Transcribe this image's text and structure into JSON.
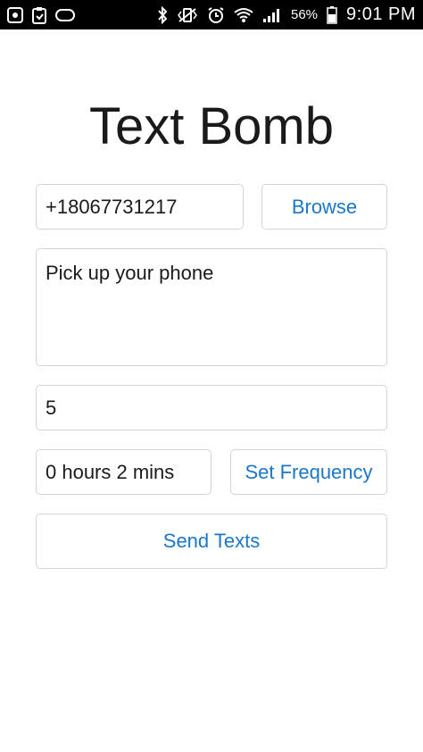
{
  "status_bar": {
    "battery_percent": "56%",
    "time": "9:01 PM",
    "icons": [
      "screenshot-icon",
      "clipboard-icon",
      "voicemail-icon",
      "bluetooth-icon",
      "vibrate-icon",
      "alarm-icon",
      "wifi-icon",
      "signal-icon",
      "battery-icon"
    ]
  },
  "app": {
    "title": "Text Bomb"
  },
  "form": {
    "phone_number": "+18067731217",
    "browse_label": "Browse",
    "message": "Pick up your phone",
    "count": "5",
    "frequency": "0 hours 2 mins",
    "set_frequency_label": "Set Frequency",
    "send_label": "Send Texts"
  }
}
